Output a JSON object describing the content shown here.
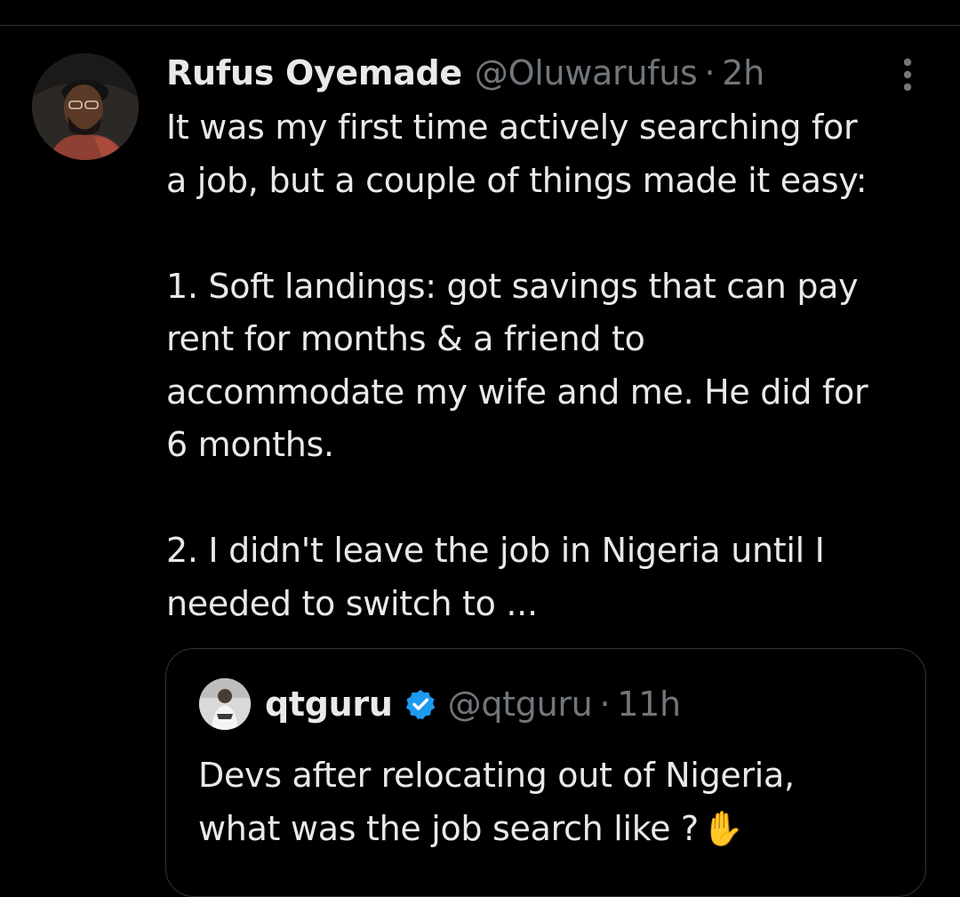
{
  "tweet": {
    "author": {
      "display_name": "Rufus Oyemade",
      "handle": "@Oluwarufus",
      "time": "2h"
    },
    "separator": "·",
    "lines": [
      "It was my first time actively searching for",
      "a job, but a couple of things made it easy:",
      "",
      "1. Soft landings: got savings that can pay",
      "rent for months & a friend to",
      "accommodate my wife and me. He did for",
      "6 months.",
      "",
      "2. I didn't leave the job in Nigeria until I",
      "needed to switch to ..."
    ],
    "more_icon": "more-vertical-icon"
  },
  "quote": {
    "author": {
      "display_name": "qtguru",
      "handle": "@qtguru",
      "time": "11h",
      "verified_icon": "verified-badge-icon"
    },
    "separator": "·",
    "lines": [
      "Devs after relocating out of Nigeria,",
      "what was the job search like ?"
    ],
    "emoji": "✋"
  },
  "colors": {
    "background": "#000000",
    "text": "#e7e9ea",
    "secondary": "#71767b",
    "border": "#2f3336",
    "verified": "#1d9bf0"
  }
}
